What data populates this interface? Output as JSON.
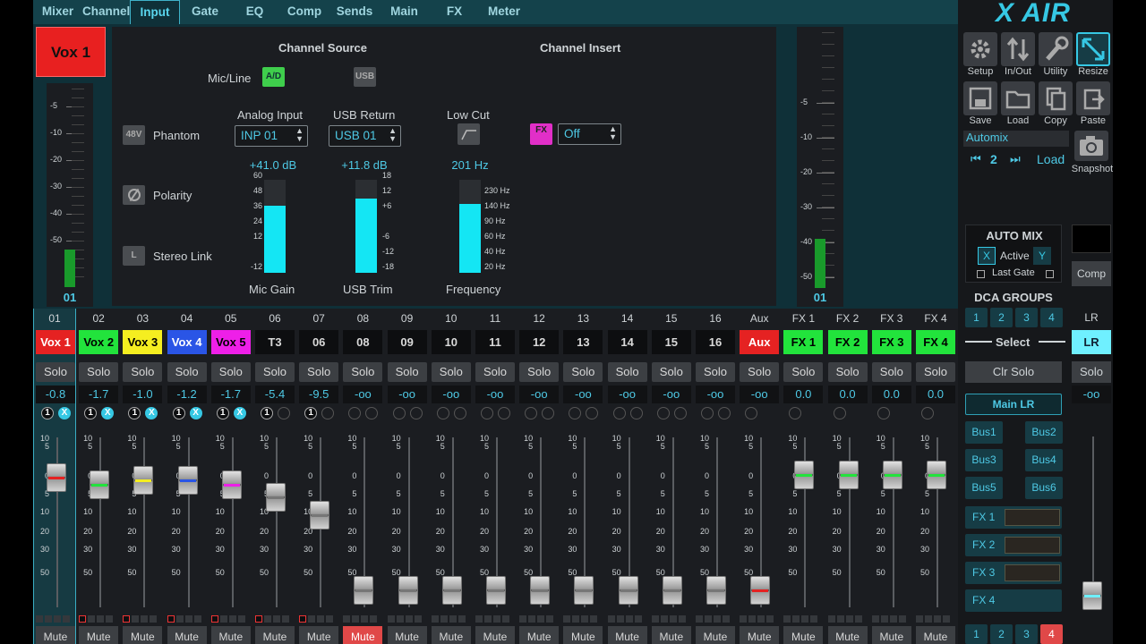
{
  "tabs": [
    {
      "label": "Mixer"
    },
    {
      "label": "Channel"
    },
    {
      "label": "Input"
    },
    {
      "label": "Gate"
    },
    {
      "label": "EQ"
    },
    {
      "label": "Comp"
    },
    {
      "label": "Sends"
    },
    {
      "label": "Main"
    },
    {
      "label": "FX"
    },
    {
      "label": "Meter"
    }
  ],
  "active_tab": "Input",
  "channel": {
    "name": "Vox 1",
    "number": "01",
    "color": "#e82020"
  },
  "input": {
    "channel_source": "Channel Source",
    "channel_insert": "Channel Insert",
    "micline_label": "Mic/Line",
    "ad_btn": "A/D",
    "usb_btn": "USB",
    "phantom_btn": "48V",
    "phantom_label": "Phantom",
    "polarity_label": "Polarity",
    "stereo_btn": "L",
    "stereo_label": "Stereo Link",
    "analog_input_label": "Analog Input",
    "analog_input_value": "INP 01",
    "usb_return_label": "USB Return",
    "usb_return_value": "USB 01",
    "lowcut_label": "Low Cut",
    "fx_btn": "FX",
    "insert_value": "Off",
    "mic_gain_value": "+41.0 dB",
    "usb_trim_value": "+11.8 dB",
    "frequency_value": "201 Hz",
    "mic_gain_label": "Mic Gain",
    "usb_trim_label": "USB Trim",
    "frequency_label": "Frequency",
    "mic_gain_fill": 0.72,
    "usb_trim_fill": 0.8,
    "freq_fill": 0.74,
    "gain_ticks": [
      "60",
      "48",
      "36",
      "24",
      "12",
      "-12"
    ],
    "trim_ticks": [
      "18",
      "12",
      "+6",
      "-6",
      "-12",
      "-18"
    ],
    "freq_ticks": [
      "230 Hz",
      "140 Hz",
      "90 Hz",
      "60 Hz",
      "40 Hz",
      "20 Hz"
    ],
    "meter_ticks": [
      "-5",
      "-10",
      "-20",
      "-30",
      "-40",
      "-50"
    ],
    "meter_ticks_right": [
      "-5",
      "-10",
      "-20",
      "-30",
      "-40",
      "-50"
    ]
  },
  "strip": {
    "columns": [
      {
        "num": "01",
        "name": "Vox 1",
        "bg": "#e52222",
        "fg": "#ffffff",
        "level": "-0.8",
        "stripe": "#e52222",
        "k": 0.235,
        "solo": "Solo",
        "mute": "Mute"
      },
      {
        "num": "02",
        "name": "Vox 2",
        "bg": "#22e33c",
        "fg": "#000000",
        "level": "-1.7",
        "stripe": "#22e33c",
        "k": 0.28,
        "solo": "Solo",
        "mute": "Mute"
      },
      {
        "num": "03",
        "name": "Vox 3",
        "bg": "#f5ee20",
        "fg": "#000000",
        "level": "-1.0",
        "stripe": "#f5ee20",
        "k": 0.25,
        "solo": "Solo",
        "mute": "Mute"
      },
      {
        "num": "04",
        "name": "Vox 4",
        "bg": "#2a55e6",
        "fg": "#ffffff",
        "level": "-1.2",
        "stripe": "#2a55e6",
        "k": 0.25,
        "solo": "Solo",
        "mute": "Mute"
      },
      {
        "num": "05",
        "name": "Vox 5",
        "bg": "#ee1fe8",
        "fg": "#000000",
        "level": "-1.7",
        "stripe": "#ee1fe8",
        "k": 0.28,
        "solo": "Solo",
        "mute": "Mute"
      },
      {
        "num": "06",
        "name": "T3",
        "bg": "#0d0e10",
        "fg": "#d9d9d9",
        "level": "-5.4",
        "stripe": "#777777",
        "k": 0.35,
        "solo": "Solo",
        "mute": "Mute"
      },
      {
        "num": "07",
        "name": "06",
        "bg": "#0d0e10",
        "fg": "#d9d9d9",
        "level": "-9.5",
        "stripe": "#777777",
        "k": 0.46,
        "solo": "Solo",
        "mute": "Mute"
      },
      {
        "num": "08",
        "name": "08",
        "bg": "#0d0e10",
        "fg": "#d9d9d9",
        "level": "-oo",
        "stripe": "#777777",
        "k": 0.9,
        "solo": "Solo",
        "mute": "Mute",
        "mute_on": true
      },
      {
        "num": "09",
        "name": "09",
        "bg": "#0d0e10",
        "fg": "#d9d9d9",
        "level": "-oo",
        "stripe": "#777777",
        "k": 0.9,
        "solo": "Solo",
        "mute": "Mute"
      },
      {
        "num": "10",
        "name": "10",
        "bg": "#0d0e10",
        "fg": "#d9d9d9",
        "level": "-oo",
        "stripe": "#777777",
        "k": 0.9,
        "solo": "Solo",
        "mute": "Mute"
      },
      {
        "num": "11",
        "name": "11",
        "bg": "#0d0e10",
        "fg": "#d9d9d9",
        "level": "-oo",
        "stripe": "#777777",
        "k": 0.9,
        "solo": "Solo",
        "mute": "Mute"
      },
      {
        "num": "12",
        "name": "12",
        "bg": "#0d0e10",
        "fg": "#d9d9d9",
        "level": "-oo",
        "stripe": "#777777",
        "k": 0.9,
        "solo": "Solo",
        "mute": "Mute"
      },
      {
        "num": "13",
        "name": "13",
        "bg": "#0d0e10",
        "fg": "#d9d9d9",
        "level": "-oo",
        "stripe": "#777777",
        "k": 0.9,
        "solo": "Solo",
        "mute": "Mute"
      },
      {
        "num": "14",
        "name": "14",
        "bg": "#0d0e10",
        "fg": "#d9d9d9",
        "level": "-oo",
        "stripe": "#777777",
        "k": 0.9,
        "solo": "Solo",
        "mute": "Mute"
      },
      {
        "num": "15",
        "name": "15",
        "bg": "#0d0e10",
        "fg": "#d9d9d9",
        "level": "-oo",
        "stripe": "#777777",
        "k": 0.9,
        "solo": "Solo",
        "mute": "Mute"
      },
      {
        "num": "16",
        "name": "16",
        "bg": "#0d0e10",
        "fg": "#d9d9d9",
        "level": "-oo",
        "stripe": "#777777",
        "k": 0.9,
        "solo": "Solo",
        "mute": "Mute"
      },
      {
        "num": "Aux",
        "name": "Aux",
        "bg": "#e52222",
        "fg": "#ffffff",
        "level": "-oo",
        "stripe": "#e52222",
        "k": 0.9,
        "solo": "Solo",
        "mute": "Mute"
      },
      {
        "num": "FX 1",
        "name": "FX 1",
        "bg": "#22e33c",
        "fg": "#000000",
        "level": "0.0",
        "stripe": "#22e33c",
        "k": 0.22,
        "solo": "Solo",
        "mute": "Mute"
      },
      {
        "num": "FX 2",
        "name": "FX 2",
        "bg": "#22e33c",
        "fg": "#000000",
        "level": "0.0",
        "stripe": "#22e33c",
        "k": 0.22,
        "solo": "Solo",
        "mute": "Mute"
      },
      {
        "num": "FX 3",
        "name": "FX 3",
        "bg": "#22e33c",
        "fg": "#000000",
        "level": "0.0",
        "stripe": "#22e33c",
        "k": 0.22,
        "solo": "Solo",
        "mute": "Mute"
      },
      {
        "num": "FX 4",
        "name": "FX 4",
        "bg": "#22e33c",
        "fg": "#000000",
        "level": "0.0",
        "stripe": "#22e33c",
        "k": 0.22,
        "solo": "Solo",
        "mute": "Mute"
      }
    ],
    "fader_scale": [
      "10",
      "5",
      "0",
      "5",
      "10",
      "20",
      "30",
      "50"
    ],
    "ind_x": "X",
    "ind_one": "1"
  },
  "right": {
    "logo": "X AIR",
    "setup": "Setup",
    "inout": "In/Out",
    "utility": "Utility",
    "resize": "Resize",
    "save": "Save",
    "load": "Load",
    "copy": "Copy",
    "paste": "Paste",
    "automix_label": "Automix",
    "snap_num": "2",
    "snap_load": "Load",
    "snapshot": "Snapshot",
    "automix_title": "AUTO MIX",
    "x": "X",
    "active": "Active",
    "y": "Y",
    "last_gate": "Last Gate",
    "comp": "Comp",
    "dca_title": "DCA GROUPS",
    "dca": [
      "1",
      "2",
      "3",
      "4"
    ],
    "select": "Select",
    "clr_solo": "Clr Solo",
    "main_lr": "Main LR",
    "bus": [
      "Bus1",
      "Bus2",
      "Bus3",
      "Bus4",
      "Bus5",
      "Bus6"
    ],
    "fx": [
      "FX 1",
      "FX 2",
      "FX 3",
      "FX 4"
    ],
    "bottom": [
      "1",
      "2",
      "3",
      "4"
    ],
    "lr_num": "LR",
    "lr_name": "LR",
    "lr_solo": "Solo",
    "lr_level": "-oo"
  }
}
